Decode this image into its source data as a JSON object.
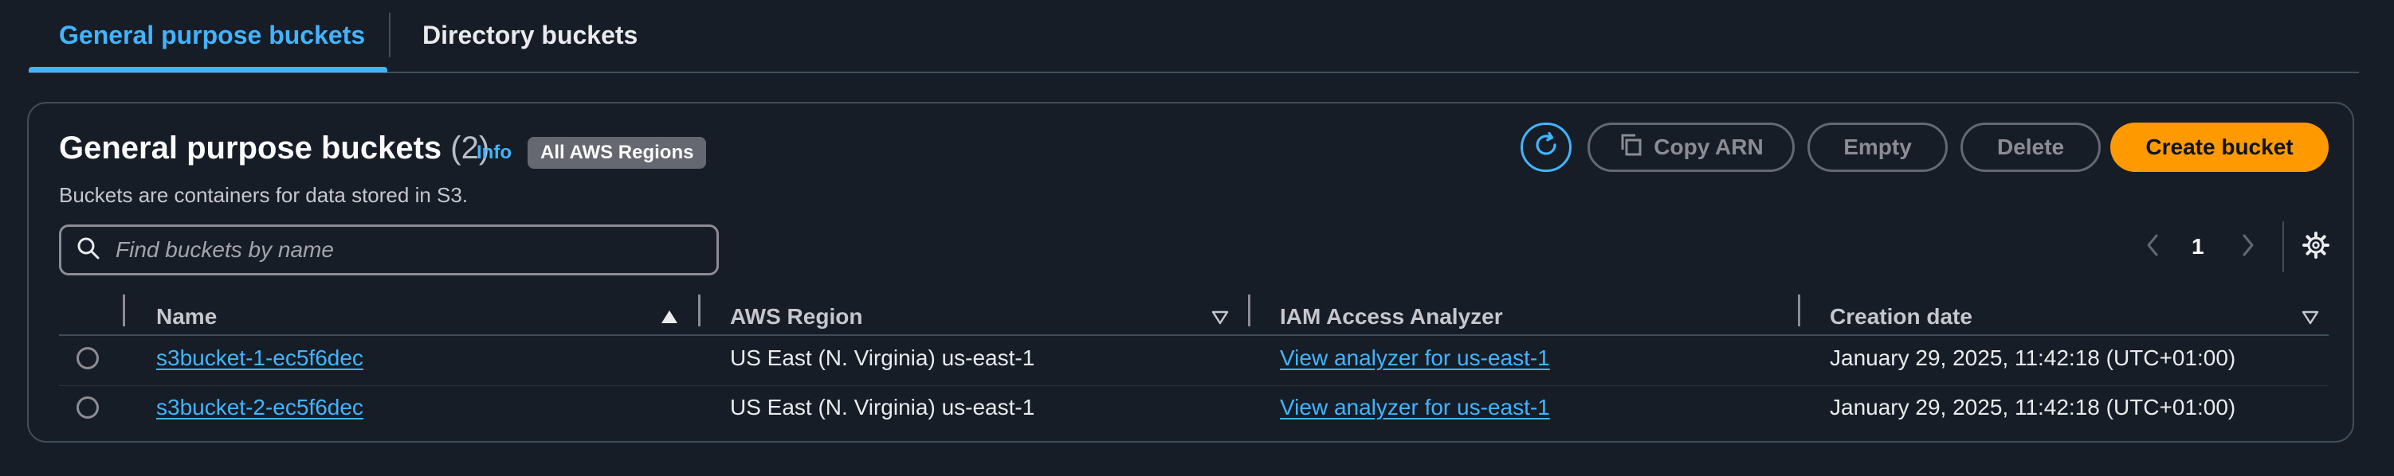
{
  "tabs": {
    "active_label": "General purpose buckets",
    "inactive_label": "Directory buckets"
  },
  "header": {
    "title": "General purpose buckets",
    "count": "(2)",
    "info_label": "Info",
    "region_badge": "All AWS Regions",
    "subtitle": "Buckets are containers for data stored in S3."
  },
  "actions": {
    "copy_arn_label": "Copy ARN",
    "empty_label": "Empty",
    "delete_label": "Delete",
    "create_label": "Create bucket"
  },
  "search": {
    "placeholder": "Find buckets by name",
    "value": ""
  },
  "pagination": {
    "current_page": "1"
  },
  "table": {
    "columns": [
      "Name",
      "AWS Region",
      "IAM Access Analyzer",
      "Creation date"
    ],
    "rows": [
      {
        "name": "s3bucket-1-ec5f6dec",
        "region": "US East (N. Virginia) us-east-1",
        "analyzer": "View analyzer for us-east-1",
        "created": "January 29, 2025, 11:42:18 (UTC+01:00)"
      },
      {
        "name": "s3bucket-2-ec5f6dec",
        "region": "US East (N. Virginia) us-east-1",
        "analyzer": "View analyzer for us-east-1",
        "created": "January 29, 2025, 11:42:18 (UTC+01:00)"
      }
    ]
  },
  "icons": {
    "refresh": "refresh-icon",
    "copy": "copy-icon",
    "search": "search-icon",
    "prev": "chevron-left-icon",
    "next": "chevron-right-icon",
    "settings": "gear-icon",
    "sort_asc": "sort-ascending-icon",
    "sort_desc": "sort-descending-icon"
  },
  "colors": {
    "background": "#161d26",
    "accent": "#42b4ff",
    "primary_button": "#ff9900",
    "border": "#414d5c"
  }
}
